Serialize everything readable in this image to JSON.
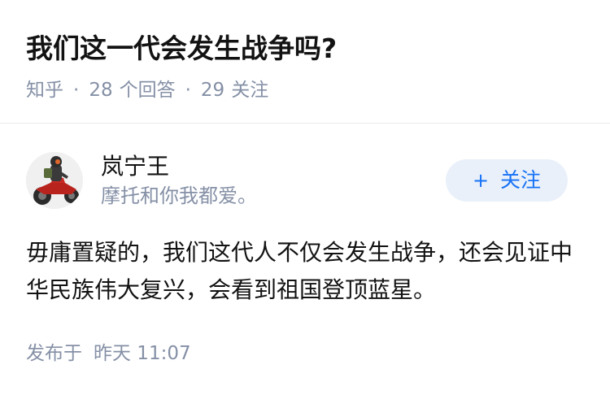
{
  "question": {
    "title": "我们这一代会发生战争吗?",
    "meta": {
      "source": "知乎",
      "separator": "·",
      "answers_count": "28",
      "answers_label": "个回答",
      "followers_count": "29",
      "followers_label": "关注"
    }
  },
  "author": {
    "name": "岚宁王",
    "bio": "摩托和你我都爱。",
    "avatar_icon": "motorcycle-rider-avatar"
  },
  "follow_button": {
    "plus": "+",
    "label": "关注"
  },
  "answer": {
    "content": "毋庸置疑的，我们这代人不仅会发生战争，还会见证中华民族伟大复兴，会看到祖国登顶蓝星。"
  },
  "publish": {
    "label": "发布于",
    "time": "昨天 11:07"
  },
  "colors": {
    "text_primary": "#121212",
    "text_secondary": "#8590a6",
    "accent": "#1772f6",
    "follow_bg": "#e9f0fa",
    "divider": "#ebebeb"
  }
}
